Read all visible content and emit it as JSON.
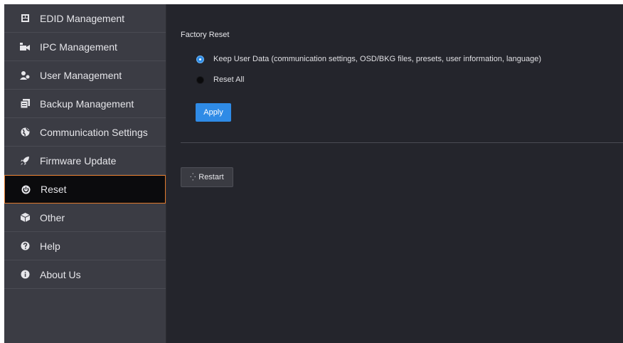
{
  "sidebar": {
    "items": [
      {
        "label": "EDID Management",
        "icon": "edid-icon"
      },
      {
        "label": "IPC Management",
        "icon": "ipc-icon"
      },
      {
        "label": "User Management",
        "icon": "user-icon"
      },
      {
        "label": "Backup Management",
        "icon": "backup-icon"
      },
      {
        "label": "Communication Settings",
        "icon": "globe-icon"
      },
      {
        "label": "Firmware Update",
        "icon": "rocket-icon"
      },
      {
        "label": "Reset",
        "icon": "power-icon",
        "active": true
      },
      {
        "label": "Other",
        "icon": "cube-icon"
      },
      {
        "label": "Help",
        "icon": "question-icon"
      },
      {
        "label": "About Us",
        "icon": "info-icon"
      }
    ]
  },
  "main": {
    "section_title": "Factory Reset",
    "options": [
      {
        "label": "Keep User Data (communication settings, OSD/BKG files, presets, user information, language)",
        "checked": true
      },
      {
        "label": "Reset All",
        "checked": false
      }
    ],
    "apply_label": "Apply",
    "restart_label": "Restart"
  },
  "colors": {
    "accent": "#2f8be6",
    "active_border": "#e0782b",
    "background": "#24252c",
    "sidebar": "#3b3c44"
  }
}
